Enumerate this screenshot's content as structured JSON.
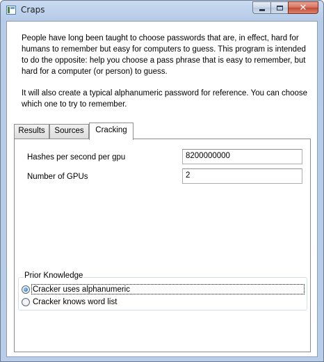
{
  "window": {
    "title": "Craps",
    "icon": "app-window-icon",
    "minimize_icon": "minimize-icon",
    "maximize_icon": "maximize-icon",
    "close_icon": "close-icon",
    "close_glyph": "✕"
  },
  "intro": {
    "paragraph1": "People have long been taught to choose passwords that are, in effect, hard for humans to remember but easy for computers to guess. This program is intended to do the opposite: help you choose a pass phrase that is easy to remember, but hard for a computer (or person) to guess.",
    "paragraph2": "It will also create a typical alphanumeric password for reference. You can choose which one to try to remember."
  },
  "tabs": [
    {
      "label": "Results",
      "selected": false
    },
    {
      "label": "Sources",
      "selected": false
    },
    {
      "label": "Cracking",
      "selected": true
    }
  ],
  "cracking": {
    "hashes_label": "Hashes per second per gpu",
    "hashes_value": "8200000000",
    "gpus_label": "Number of GPUs",
    "gpus_value": "2",
    "prior_knowledge": {
      "title": "Prior Knowledge",
      "options": [
        {
          "label": "Cracker uses alphanumeric",
          "checked": true
        },
        {
          "label": "Cracker knows word list",
          "checked": false
        }
      ]
    }
  }
}
